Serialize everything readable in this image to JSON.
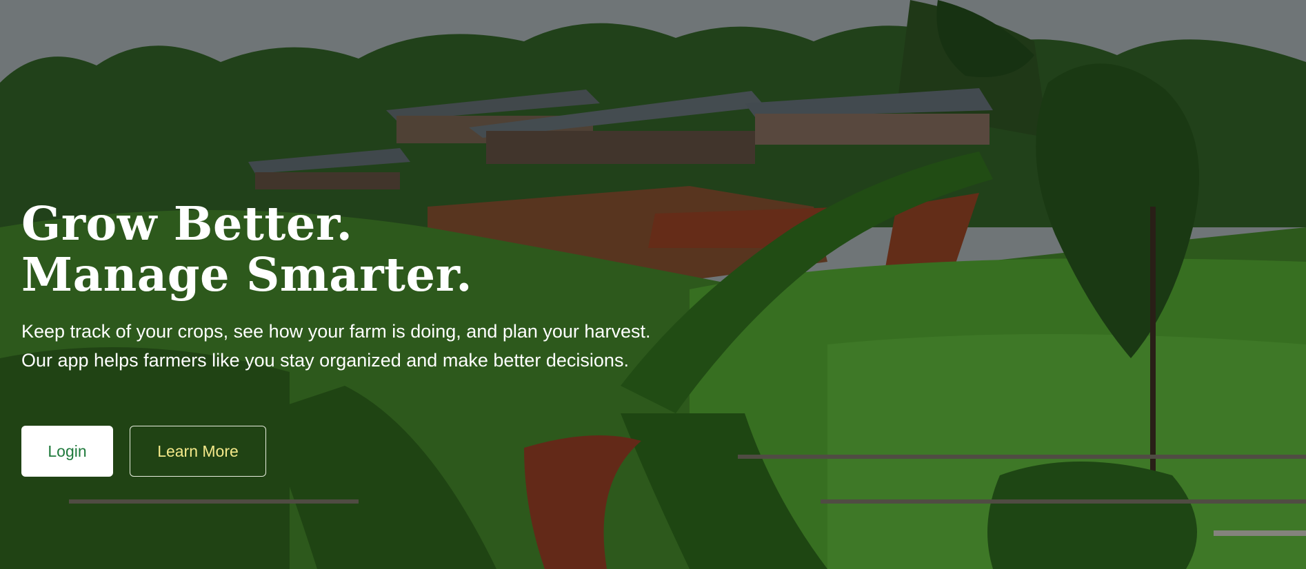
{
  "hero": {
    "headline": "Grow Better. Manage Smarter.",
    "subtext": "Keep track of your crops, see how your farm is doing, and plan your harvest. Our app helps farmers like you stay organized and make better decisions.",
    "background_image": "coffee farm terraced hillside with sheds",
    "overlay_color": "#000000"
  },
  "actions": {
    "login_label": "Login",
    "learn_more_label": "Learn More",
    "login_text_color": "#1f7a3c",
    "learn_more_text_color": "#f4e98a"
  }
}
